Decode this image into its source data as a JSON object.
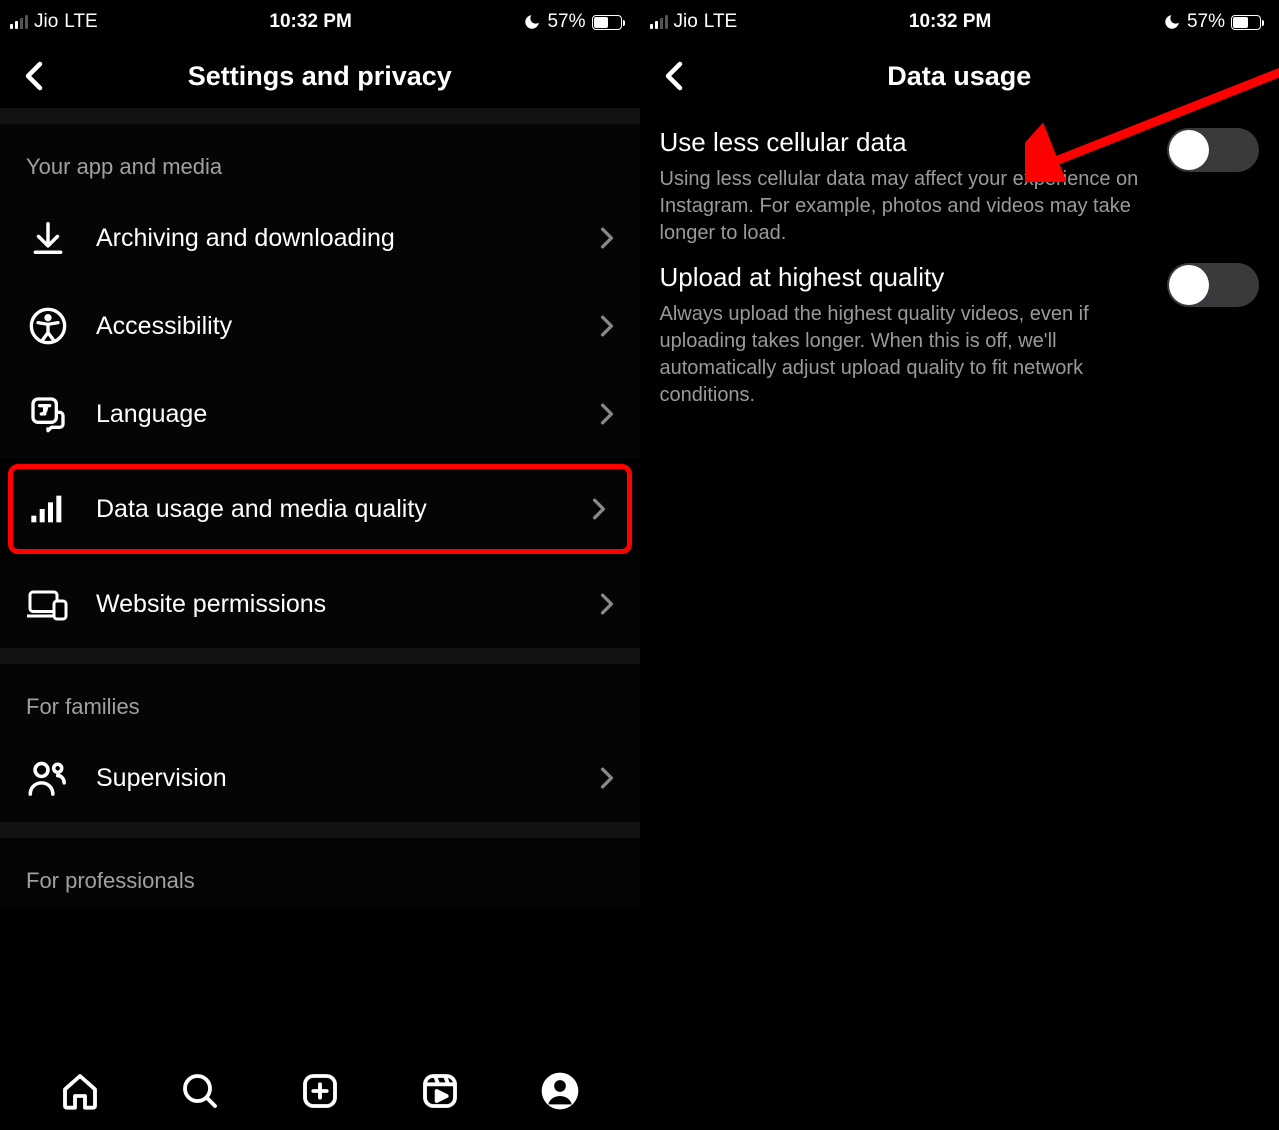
{
  "status": {
    "carrier": "Jio",
    "network": "LTE",
    "time": "10:32 PM",
    "battery_pct": "57%"
  },
  "left": {
    "title": "Settings and privacy",
    "sections": [
      {
        "header": "Your app and media",
        "rows": [
          {
            "icon": "download-icon",
            "label": "Archiving and downloading",
            "highlight": false
          },
          {
            "icon": "accessibility-icon",
            "label": "Accessibility",
            "highlight": false
          },
          {
            "icon": "language-icon",
            "label": "Language",
            "highlight": false
          },
          {
            "icon": "cellular-bars-icon",
            "label": "Data usage and media quality",
            "highlight": true
          },
          {
            "icon": "devices-icon",
            "label": "Website permissions",
            "highlight": false
          }
        ]
      },
      {
        "header": "For families",
        "rows": [
          {
            "icon": "supervision-icon",
            "label": "Supervision",
            "highlight": false
          }
        ]
      },
      {
        "header": "For professionals",
        "rows": []
      }
    ]
  },
  "right": {
    "title": "Data usage",
    "settings": [
      {
        "title": "Use less cellular data",
        "desc": "Using less cellular data may affect your experience on Instagram. For example, photos and videos may take longer to load.",
        "on": false
      },
      {
        "title": "Upload at highest quality",
        "desc": "Always upload the highest quality videos, even if uploading takes longer. When this is off, we'll automatically adjust upload quality to fit network conditions.",
        "on": false
      }
    ]
  },
  "tabs": [
    "home",
    "search",
    "create",
    "reels",
    "profile"
  ]
}
